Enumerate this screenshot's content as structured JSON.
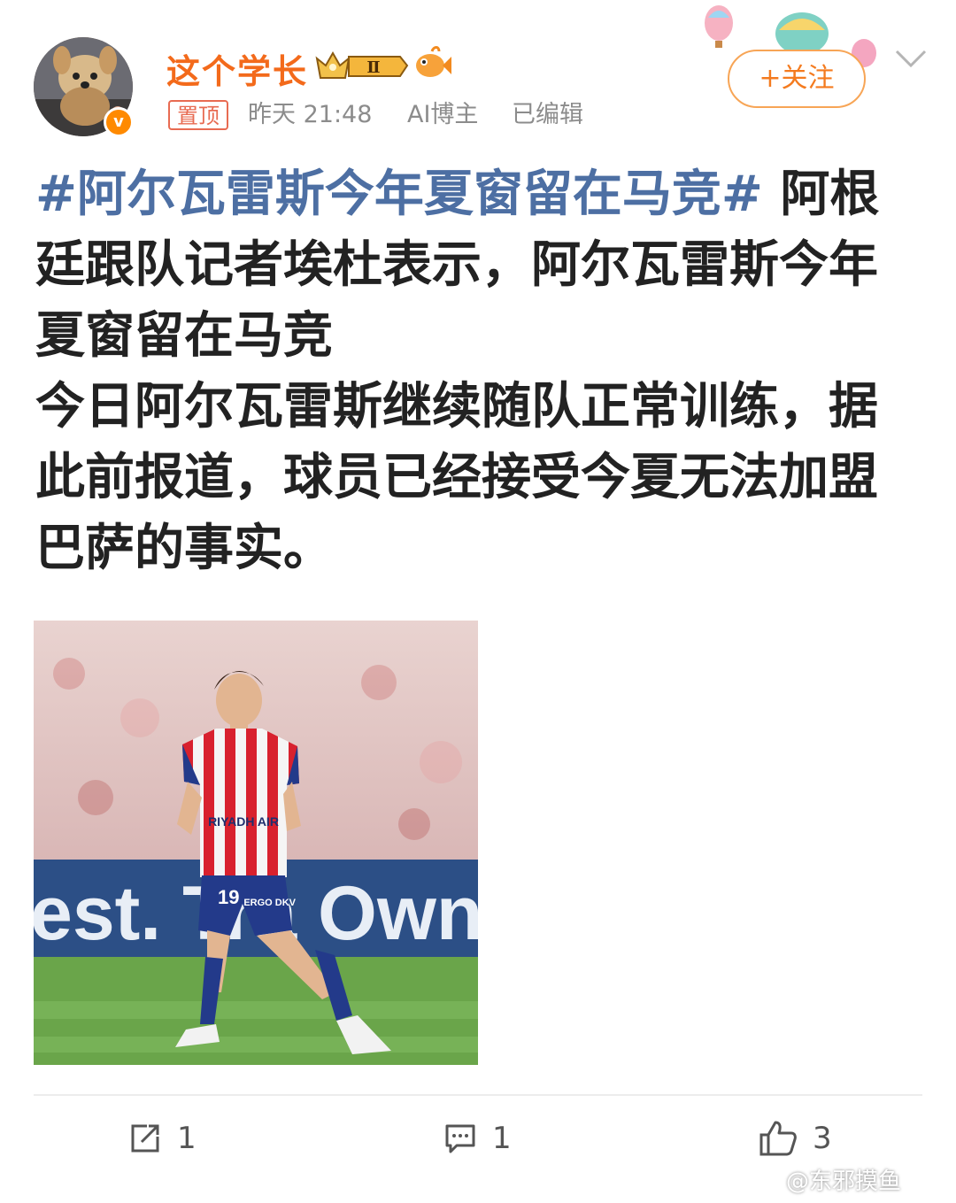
{
  "author": {
    "name": "这个学长",
    "vip_level": "Ⅱ",
    "verified_mark": "v"
  },
  "post_meta": {
    "pinned_label": "置顶",
    "time": "昨天 21:48",
    "role": "AI博主",
    "edited": "已编辑"
  },
  "follow_label": "+关注",
  "post": {
    "hashtag": "#阿尔瓦雷斯今年夏窗留在马竞#",
    "line1_rest": " 阿根廷跟队记者埃杜表示，阿尔瓦雷斯今年夏窗留在马竞",
    "line2": "今日阿尔瓦雷斯继续随队正常训练，据此前报道，球员已经接受今夏无法加盟巴萨的事实。"
  },
  "photo": {
    "jersey_number": "19",
    "sponsor": "RIYADH AIR",
    "shorts_text": "ERGO DKV",
    "board_text": "est. Tra  Own"
  },
  "actions": {
    "repost_count": "1",
    "comment_count": "1",
    "like_count": "3"
  },
  "watermark": "@东邪摸鱼",
  "colors": {
    "username": "#f36a1b",
    "hashtag": "#4d6fa3",
    "follow": "#f47b1f",
    "pinned": "#e86b52"
  },
  "icons": [
    "verified-icon",
    "vip-crown-icon",
    "fish-icon",
    "balloon-icon",
    "chevron-down-icon",
    "repost-icon",
    "comment-icon",
    "like-icon",
    "weibo-logo-icon"
  ]
}
